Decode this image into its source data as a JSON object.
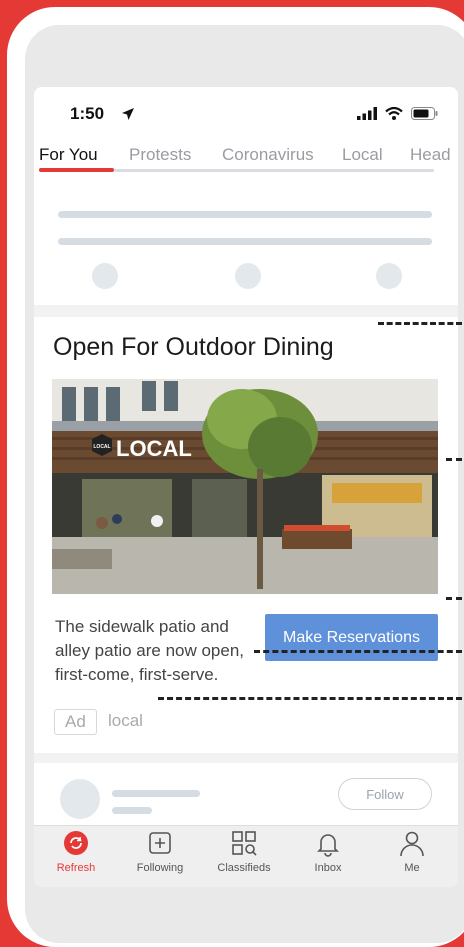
{
  "status_bar": {
    "time": "1:50"
  },
  "tabs": [
    {
      "label": "For You",
      "active": true
    },
    {
      "label": "Protests",
      "active": false
    },
    {
      "label": "Coronavirus",
      "active": false
    },
    {
      "label": "Local",
      "active": false
    },
    {
      "label": "Head",
      "active": false
    }
  ],
  "ad": {
    "title": "Open For Outdoor Dining",
    "image_sign": "LOCAL",
    "image_sign_small": "LOCAL",
    "description": "The sidewalk patio and alley patio are now open, first-come, first-serve.",
    "cta_label": "Make Reservations",
    "badge": "Ad",
    "source": "local"
  },
  "next_card": {
    "follow_label": "Follow"
  },
  "bottom_nav": [
    {
      "label": "Refresh",
      "icon": "refresh-icon",
      "active": true
    },
    {
      "label": "Following",
      "icon": "plus-square-icon",
      "active": false
    },
    {
      "label": "Classifieds",
      "icon": "classifieds-icon",
      "active": false
    },
    {
      "label": "Inbox",
      "icon": "bell-icon",
      "active": false
    },
    {
      "label": "Me",
      "icon": "person-icon",
      "active": false
    }
  ],
  "colors": {
    "accent": "#e53935",
    "cta": "#5f91db",
    "background": "#e53935"
  }
}
